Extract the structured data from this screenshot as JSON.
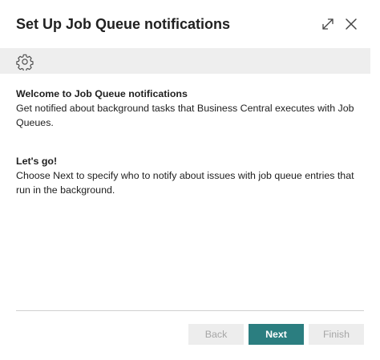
{
  "dialog": {
    "title": "Set Up Job Queue notifications",
    "controls": {
      "expand_icon": "expand-icon",
      "close_icon": "close-icon"
    }
  },
  "toolbar": {
    "settings_icon": "gear-icon"
  },
  "content": {
    "welcome_heading": "Welcome to Job Queue notifications",
    "welcome_text": "Get notified about background tasks that Business Central executes with Job Queues.",
    "letsgo_heading": "Let's go!",
    "letsgo_text": "Choose Next to specify who to notify about issues with job queue entries that run in the background."
  },
  "footer": {
    "back_label": "Back",
    "next_label": "Next",
    "finish_label": "Finish",
    "accent_color": "#2b7e80"
  }
}
